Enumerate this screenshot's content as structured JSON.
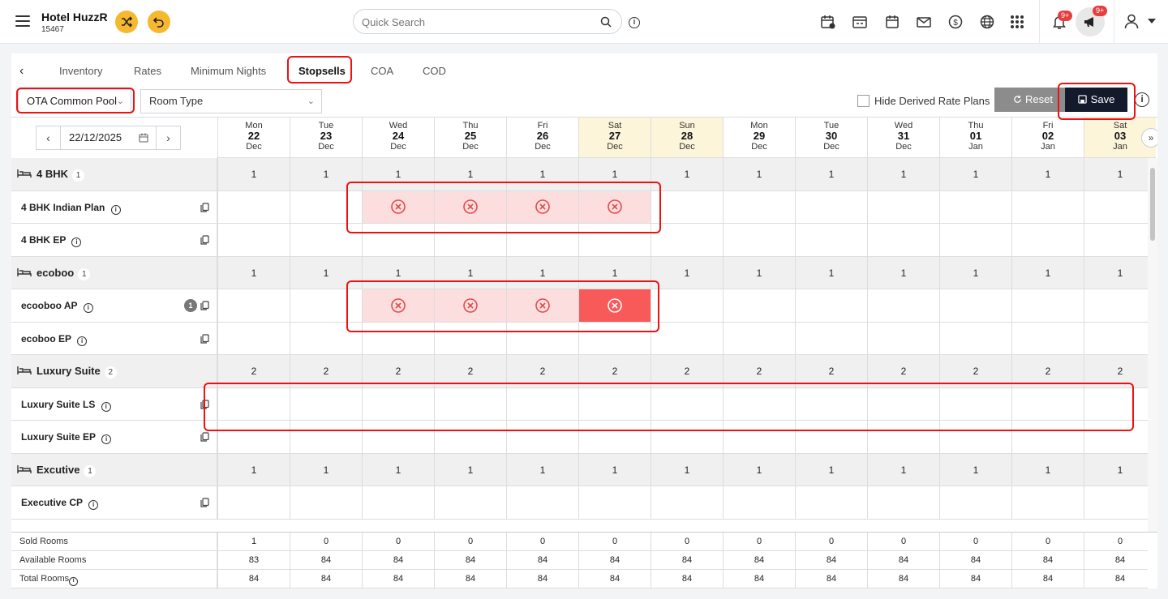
{
  "app": {
    "hotel_name": "Hotel HuzzR",
    "hotel_id": "15467",
    "search_placeholder": "Quick Search",
    "notif_badge": "9+",
    "announce_badge": "9+"
  },
  "tabs": {
    "items": [
      "Inventory",
      "Rates",
      "Minimum Nights",
      "Stopsells",
      "COA",
      "COD"
    ],
    "active": "Stopsells"
  },
  "filters": {
    "channel": "OTA Common Pool",
    "room_type_placeholder": "Room Type",
    "hide_derived_label": "Hide Derived Rate Plans",
    "reset_label": "Reset",
    "save_label": "Save"
  },
  "date_picker": {
    "value": "22/12/2025"
  },
  "dates": [
    {
      "dow": "Mon",
      "day": "22",
      "mon": "Dec",
      "weekend": false
    },
    {
      "dow": "Tue",
      "day": "23",
      "mon": "Dec",
      "weekend": false
    },
    {
      "dow": "Wed",
      "day": "24",
      "mon": "Dec",
      "weekend": false
    },
    {
      "dow": "Thu",
      "day": "25",
      "mon": "Dec",
      "weekend": false
    },
    {
      "dow": "Fri",
      "day": "26",
      "mon": "Dec",
      "weekend": false
    },
    {
      "dow": "Sat",
      "day": "27",
      "mon": "Dec",
      "weekend": true
    },
    {
      "dow": "Sun",
      "day": "28",
      "mon": "Dec",
      "weekend": true
    },
    {
      "dow": "Mon",
      "day": "29",
      "mon": "Dec",
      "weekend": false
    },
    {
      "dow": "Tue",
      "day": "30",
      "mon": "Dec",
      "weekend": false
    },
    {
      "dow": "Wed",
      "day": "31",
      "mon": "Dec",
      "weekend": false
    },
    {
      "dow": "Thu",
      "day": "01",
      "mon": "Jan",
      "weekend": false
    },
    {
      "dow": "Fri",
      "day": "02",
      "mon": "Jan",
      "weekend": false
    },
    {
      "dow": "Sat",
      "day": "03",
      "mon": "Jan",
      "weekend": true
    }
  ],
  "rows": [
    {
      "type": "room",
      "name": "4 BHK",
      "count": "1",
      "values": [
        "1",
        "1",
        "1",
        "1",
        "1",
        "1",
        "1",
        "1",
        "1",
        "1",
        "1",
        "1",
        "1"
      ]
    },
    {
      "type": "plan",
      "name": "4 BHK Indian Plan",
      "stop": [
        "",
        "",
        "s",
        "s",
        "s",
        "s",
        "",
        "",
        "",
        "",
        "",
        "",
        ""
      ]
    },
    {
      "type": "plan",
      "name": "4 BHK EP",
      "stop": [
        "",
        "",
        "",
        "",
        "",
        "",
        "",
        "",
        "",
        "",
        "",
        "",
        ""
      ]
    },
    {
      "type": "room",
      "name": "ecoboo",
      "count": "1",
      "values": [
        "1",
        "1",
        "1",
        "1",
        "1",
        "1",
        "1",
        "1",
        "1",
        "1",
        "1",
        "1",
        "1"
      ]
    },
    {
      "type": "plan",
      "name": "ecooboo AP",
      "badge": "1",
      "stop": [
        "",
        "",
        "s",
        "s",
        "s",
        "d",
        "",
        "",
        "",
        "",
        "",
        "",
        ""
      ]
    },
    {
      "type": "plan",
      "name": "ecoboo EP",
      "stop": [
        "",
        "",
        "",
        "",
        "",
        "",
        "",
        "",
        "",
        "",
        "",
        "",
        ""
      ]
    },
    {
      "type": "room",
      "name": "Luxury Suite",
      "count": "2",
      "values": [
        "2",
        "2",
        "2",
        "2",
        "2",
        "2",
        "2",
        "2",
        "2",
        "2",
        "2",
        "2",
        "2"
      ]
    },
    {
      "type": "plan",
      "name": "Luxury Suite LS",
      "stop": [
        "",
        "",
        "",
        "",
        "",
        "",
        "",
        "",
        "",
        "",
        "",
        "",
        ""
      ]
    },
    {
      "type": "plan",
      "name": "Luxury Suite EP",
      "stop": [
        "",
        "",
        "",
        "",
        "",
        "",
        "",
        "",
        "",
        "",
        "",
        "",
        ""
      ]
    },
    {
      "type": "room",
      "name": "Excutive",
      "count": "1",
      "values": [
        "1",
        "1",
        "1",
        "1",
        "1",
        "1",
        "1",
        "1",
        "1",
        "1",
        "1",
        "1",
        "1"
      ]
    },
    {
      "type": "plan",
      "name": "Executive CP",
      "stop": [
        "",
        "",
        "",
        "",
        "",
        "",
        "",
        "",
        "",
        "",
        "",
        "",
        ""
      ]
    }
  ],
  "footer": [
    {
      "label": "Sold Rooms",
      "values": [
        "1",
        "0",
        "0",
        "0",
        "0",
        "0",
        "0",
        "0",
        "0",
        "0",
        "0",
        "0",
        "0"
      ]
    },
    {
      "label": "Available Rooms",
      "values": [
        "83",
        "84",
        "84",
        "84",
        "84",
        "84",
        "84",
        "84",
        "84",
        "84",
        "84",
        "84",
        "84"
      ]
    },
    {
      "label": "Total Rooms",
      "values": [
        "84",
        "84",
        "84",
        "84",
        "84",
        "84",
        "84",
        "84",
        "84",
        "84",
        "84",
        "84",
        "84"
      ]
    }
  ],
  "colors": {
    "accent_yellow": "#f5b82e",
    "stopsell_light": "#fcdede",
    "stopsell_dark": "#f85a5a",
    "weekend": "#fdf5d9",
    "save_bg": "#121a2c",
    "highlight_red": "#e11111"
  }
}
